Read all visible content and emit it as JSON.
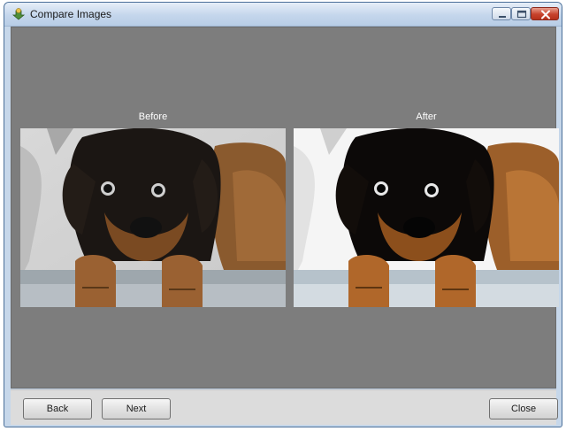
{
  "window": {
    "title": "Compare Images",
    "title_icon": "compare-images-app-icon",
    "controls": [
      "minimize-icon",
      "maximize-icon",
      "close-icon"
    ]
  },
  "images": {
    "before_label": "Before",
    "after_label": "After"
  },
  "footer": {
    "back_label": "Back",
    "next_label": "Next",
    "close_label": "Close"
  },
  "colors": {
    "content_background": "#7d7d7d",
    "footer_background": "#dcdcdc",
    "window_frame": "#c6d7ea",
    "close_button": "#c7422c"
  }
}
